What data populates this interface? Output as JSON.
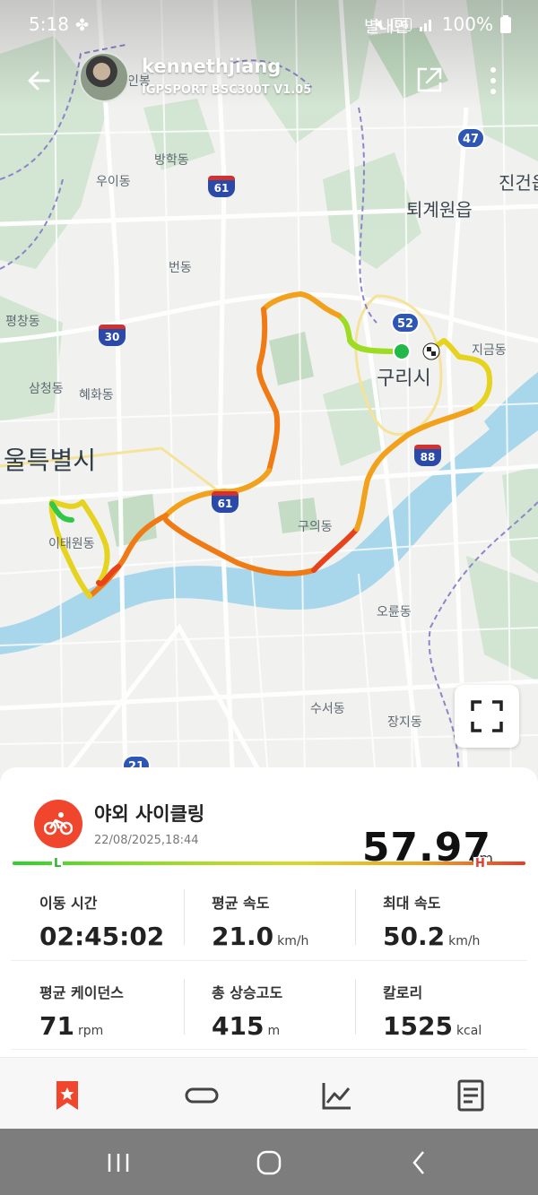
{
  "status_bar": {
    "time": "5:18",
    "battery": "100%",
    "network": "5G",
    "icons": [
      "pinwheel-icon",
      "mute-icon",
      "signal-icon",
      "battery-icon"
    ]
  },
  "header": {
    "username": "kennethjiang",
    "device": "IGPSPORT BSC300T  V1.05",
    "icons": [
      "back-arrow-icon",
      "share-icon",
      "more-vert-icon"
    ]
  },
  "map": {
    "places": [
      {
        "name": "인봉",
        "cls": ""
      },
      {
        "name": "방학동",
        "cls": ""
      },
      {
        "name": "우이동",
        "cls": ""
      },
      {
        "name": "번동",
        "cls": ""
      },
      {
        "name": "평창동",
        "cls": ""
      },
      {
        "name": "삼청동",
        "cls": ""
      },
      {
        "name": "혜화동",
        "cls": ""
      },
      {
        "name": "울특별시",
        "cls": "bigger"
      },
      {
        "name": "이태원동",
        "cls": ""
      },
      {
        "name": "구의동",
        "cls": ""
      },
      {
        "name": "오륜동",
        "cls": ""
      },
      {
        "name": "수서동",
        "cls": ""
      },
      {
        "name": "장지동",
        "cls": ""
      },
      {
        "name": "퇴계원읍",
        "cls": "big"
      },
      {
        "name": "진건읍",
        "cls": "big"
      },
      {
        "name": "구리시",
        "cls": "big"
      },
      {
        "name": "지금동",
        "cls": ""
      },
      {
        "name": "별내면",
        "cls": ""
      }
    ],
    "road_shields": [
      {
        "num": "47",
        "type": "national"
      },
      {
        "num": "52",
        "type": "national"
      },
      {
        "num": "61",
        "type": "highway"
      },
      {
        "num": "30",
        "type": "highway"
      },
      {
        "num": "88",
        "type": "highway"
      },
      {
        "num": "61",
        "type": "highway"
      },
      {
        "num": "21",
        "type": "national"
      }
    ],
    "route_colors": [
      "#31c84a",
      "#9ddc22",
      "#e6d320",
      "#f2a11c",
      "#f07a14",
      "#e8421a"
    ]
  },
  "activity": {
    "icon": "cycling-icon",
    "accent": "#f0462e",
    "title": "야외 사이클링",
    "date": "22/08/2025,18:44",
    "distance": "57.97",
    "distance_unit": "km",
    "legend_low": "L",
    "legend_high": "H"
  },
  "stats": [
    {
      "label": "이동 시간",
      "value": "02:45:02",
      "unit": ""
    },
    {
      "label": "평균 속도",
      "value": "21.0",
      "unit": "km/h"
    },
    {
      "label": "최대 속도",
      "value": "50.2",
      "unit": "km/h"
    },
    {
      "label": "평균 케이던스",
      "value": "71",
      "unit": "rpm"
    },
    {
      "label": "총 상승고도",
      "value": "415",
      "unit": "m"
    },
    {
      "label": "칼로리",
      "value": "1525",
      "unit": "kcal"
    }
  ],
  "tabs": [
    {
      "name": "summary-tab",
      "icon": "bookmark-star-icon",
      "active": true
    },
    {
      "name": "laps-tab",
      "icon": "lap-loop-icon",
      "active": false
    },
    {
      "name": "chart-tab",
      "icon": "line-chart-icon",
      "active": false
    },
    {
      "name": "details-tab",
      "icon": "document-icon",
      "active": false
    }
  ]
}
